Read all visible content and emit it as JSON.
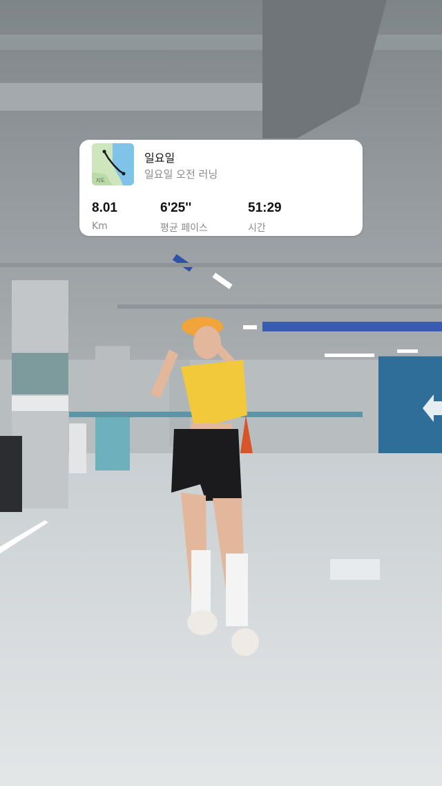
{
  "run_card": {
    "title": "일요일",
    "subtitle": "일요일 오전 러닝",
    "map_icon": "route-map-thumbnail",
    "map_label": "지도",
    "stats": [
      {
        "value": "8.01",
        "label": "Km"
      },
      {
        "value": "6'25''",
        "label": "평균 페이스"
      },
      {
        "value": "51:29",
        "label": "시간"
      }
    ]
  },
  "colors": {
    "card_bg": "#ffffff",
    "primary_text": "#111111",
    "secondary_text": "#8a8a8a",
    "map_water": "#7fc3e8",
    "map_land": "#cfe6bd",
    "route": "#1b1b1b"
  }
}
